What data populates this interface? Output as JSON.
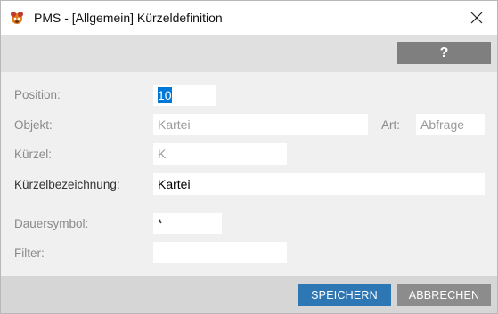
{
  "window": {
    "title": "PMS - [Allgemein] Kürzeldefinition",
    "close_glyph": "✕"
  },
  "toolbar": {
    "help_label": "?"
  },
  "form": {
    "position": {
      "label": "Position:",
      "value": "10"
    },
    "objekt": {
      "label": "Objekt:",
      "value": "Kartei"
    },
    "art": {
      "label": "Art:",
      "value": "Abfrage"
    },
    "kuerzel": {
      "label": "Kürzel:",
      "value": "K"
    },
    "kuerzelbezeichnung": {
      "label": "Kürzelbezeichnung:",
      "value": "Kartei"
    },
    "dauersymbol": {
      "label": "Dauersymbol:",
      "value": "*"
    },
    "filter": {
      "label": "Filter:",
      "value": ""
    }
  },
  "footer": {
    "save_label": "SPEICHERN",
    "cancel_label": "ABBRECHEN"
  },
  "colors": {
    "primary_button": "#2e77b5",
    "secondary_button": "#8c8c8c",
    "selection": "#0078d7"
  }
}
